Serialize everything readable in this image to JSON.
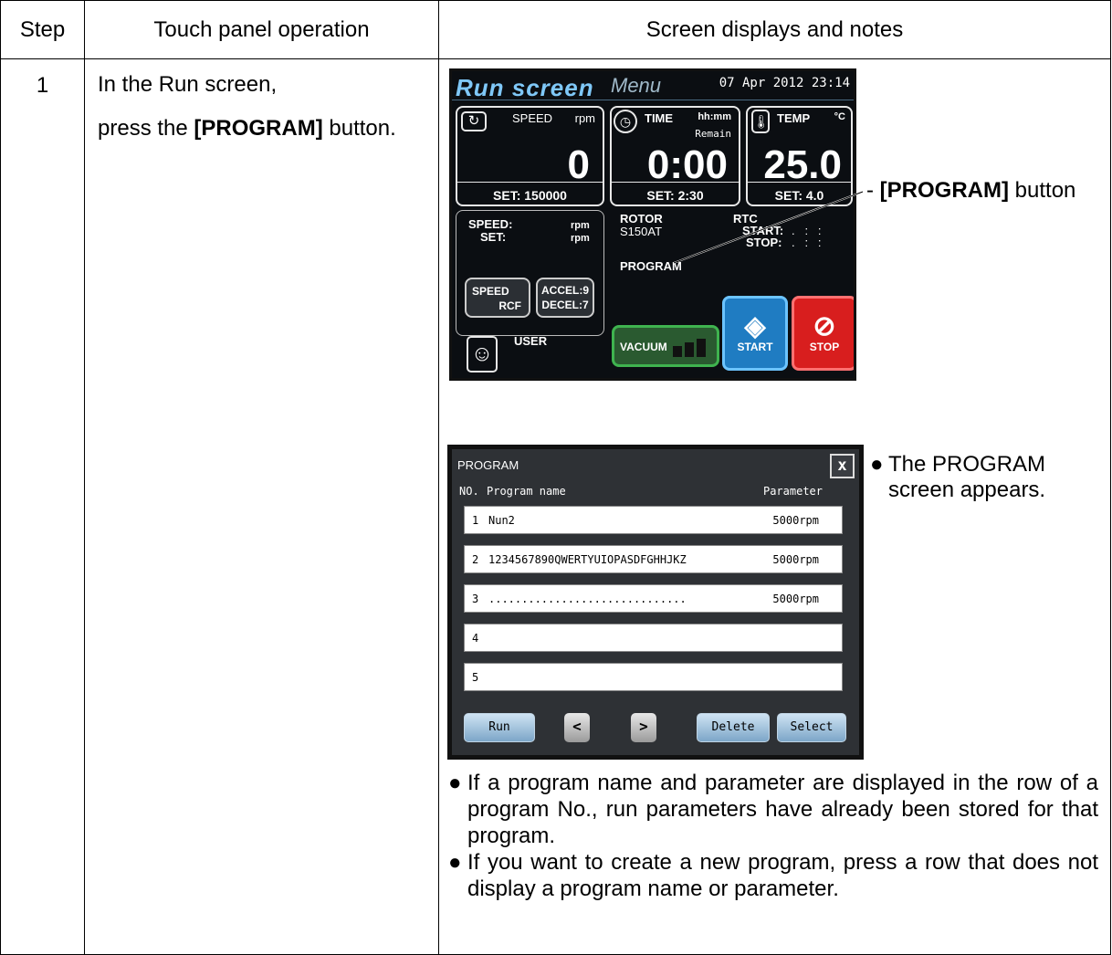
{
  "headers": {
    "step": "Step",
    "operation": "Touch panel operation",
    "notes": "Screen displays and notes"
  },
  "row": {
    "step": "1",
    "op_line1": "In the Run screen,",
    "op_line2_pre": "press the ",
    "op_line2_bold": "[PROGRAM]",
    "op_line2_post": " button."
  },
  "run_screen": {
    "tab_run": "Run screen",
    "tab_menu": "Menu",
    "datetime": "07 Apr 2012 23:14",
    "speed_label": "SPEED",
    "speed_unit": "rpm",
    "speed_value": "0",
    "speed_set": "SET:  150000",
    "time_label": "TIME",
    "time_unit": "hh:mm",
    "time_sub": "Remain",
    "time_value": "0:00",
    "time_set": "SET:  2:30",
    "temp_label": "TEMP",
    "temp_unit": "°C",
    "temp_value": "25.0",
    "temp_set": "SET:  4.0",
    "speed_row": "SPEED:",
    "set_row": "SET:",
    "rpm1": "rpm",
    "rpm2": "rpm",
    "rotor_label": "ROTOR",
    "rotor_value": "S150AT",
    "rtc_label": "RTC",
    "rtc_start": "START:",
    "rtc_stop": "STOP:",
    "rtc_start_value": ".   :   :",
    "rtc_stop_value": ".   :   :",
    "speed_btn_top": "SPEED",
    "speed_btn_bottom": "RCF",
    "accel": "ACCEL:9",
    "decel": "DECEL:7",
    "program_label": "PROGRAM",
    "user_label": "USER",
    "vacuum": "VACUUM",
    "start": "START",
    "stop": "STOP",
    "colors": {
      "start": "#2a8fd8",
      "stop": "#e02020",
      "vacuum": "#3fb34f"
    }
  },
  "callout": {
    "bold": "[PROGRAM]",
    "text": " button"
  },
  "program_screen": {
    "title": "PROGRAM",
    "close": "x",
    "col_no": "NO.",
    "col_name": "Program name",
    "col_param": "Parameter",
    "rows": [
      {
        "no": "1",
        "name": "Nun2",
        "param": "5000rpm"
      },
      {
        "no": "2",
        "name": "1234567890QWERTYUIOPASDFGHHJKZ",
        "param": "5000rpm"
      },
      {
        "no": "3",
        "name": "..............................",
        "param": "5000rpm"
      },
      {
        "no": "4",
        "name": "",
        "param": ""
      },
      {
        "no": "5",
        "name": "",
        "param": ""
      }
    ],
    "buttons": {
      "run": "Run",
      "prev": "<",
      "next": ">",
      "delete": "Delete",
      "select": "Select"
    }
  },
  "program_note": {
    "line1": "The PROGRAM",
    "line2": "screen appears."
  },
  "bullet": "●",
  "notes": [
    "If a program name and parameter are displayed in the row of a program No., run parameters have already been stored for that program.",
    "If you want to create a new program, press a row that does not display a program name or parameter."
  ]
}
